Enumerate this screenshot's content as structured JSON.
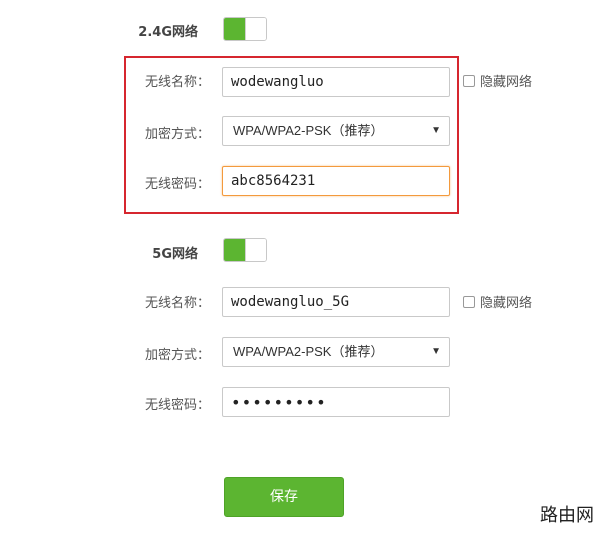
{
  "band24": {
    "title": "2.4G网络",
    "enabled": true,
    "ssid_label": "无线名称：",
    "ssid_value": "wodewangluo",
    "hide_label": "隐藏网络",
    "enc_label": "加密方式：",
    "enc_value": "WPA/WPA2-PSK（推荐）",
    "pw_label": "无线密码：",
    "pw_value": "abc8564231"
  },
  "band5": {
    "title": "5G网络",
    "enabled": true,
    "ssid_label": "无线名称：",
    "ssid_value": "wodewangluo_5G",
    "hide_label": "隐藏网络",
    "enc_label": "加密方式：",
    "enc_value": "WPA/WPA2-PSK（推荐）",
    "pw_label": "无线密码：",
    "pw_value": "•••••••••"
  },
  "save_label": "保存",
  "watermark": "路由网",
  "colors": {
    "accent": "#5cb531",
    "highlight": "#d6262f",
    "focus": "#f39a3d"
  }
}
